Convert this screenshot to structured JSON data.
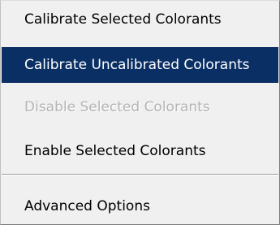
{
  "menu": {
    "items": [
      {
        "label": "Calibrate Selected Colorants",
        "state": "normal"
      },
      {
        "label": "Calibrate Uncalibrated Colorants",
        "state": "highlighted"
      },
      {
        "label": "Disable Selected Colorants",
        "state": "disabled"
      },
      {
        "label": "Enable Selected Colorants",
        "state": "normal"
      },
      {
        "label": "Advanced Options",
        "state": "normal"
      }
    ]
  },
  "colors": {
    "menu_background": "#f0f0f0",
    "highlight_background": "#0a2f64",
    "highlight_text": "#ffffff",
    "disabled_text": "#b4b4b4"
  }
}
